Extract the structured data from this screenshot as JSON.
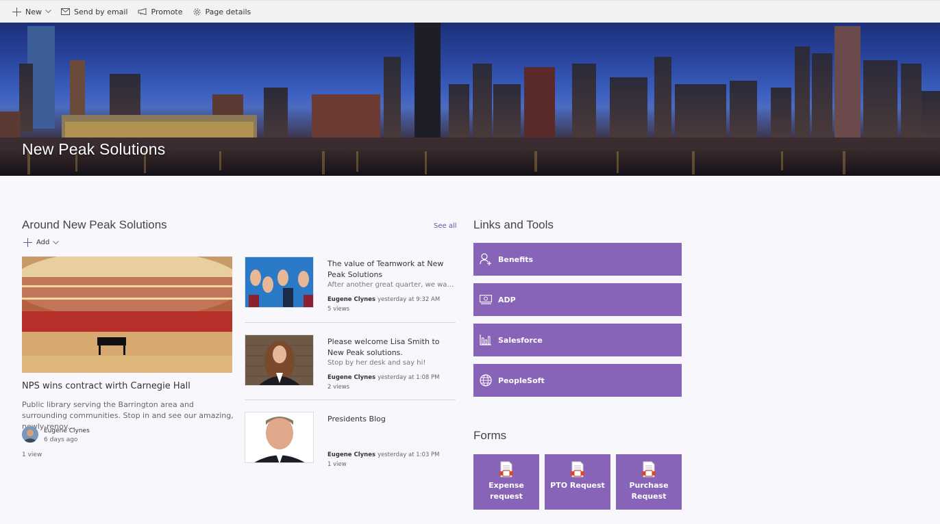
{
  "command_bar": {
    "new_label": "New",
    "send_label": "Send by email",
    "promote_label": "Promote",
    "details_label": "Page details"
  },
  "hero": {
    "title": "New Peak Solutions"
  },
  "news": {
    "title": "Around New Peak Solutions",
    "see_all": "See all",
    "add_label": "Add",
    "featured": {
      "title": "NPS wins contract wirth Carnegie Hall",
      "description": "Public library serving the Barrington area and surrounding communities. Stop in and see our amazing, newly-renov...",
      "author": "Eugene Clynes",
      "date": "6 days ago",
      "views": "1 view"
    },
    "items": [
      {
        "title": "The value of Teamwork at New Peak Solutions",
        "description": "After another great quarter, we wan...",
        "author": "Eugene Clynes",
        "date": "yesterday at 9:32 AM",
        "views": "5 views"
      },
      {
        "title": "Please welcome Lisa Smith to New Peak solutions.",
        "description": "Stop by her desk and say hi!",
        "author": "Eugene Clynes",
        "date": "yesterday at 1:08 PM",
        "views": "2 views"
      },
      {
        "title": "Presidents Blog",
        "description": "",
        "author": "Eugene Clynes",
        "date": "yesterday at 1:03 PM",
        "views": "1 view"
      }
    ]
  },
  "links": {
    "title": "Links and Tools",
    "items": [
      {
        "label": "Benefits",
        "icon": "person-add-icon"
      },
      {
        "label": "ADP",
        "icon": "money-icon"
      },
      {
        "label": "Salesforce",
        "icon": "bar-chart-icon"
      },
      {
        "label": "PeopleSoft",
        "icon": "globe-icon"
      }
    ]
  },
  "forms": {
    "title": "Forms",
    "items": [
      {
        "label": "Expense request",
        "icon": "form-document-icon"
      },
      {
        "label": "PTO Request",
        "icon": "form-document-icon"
      },
      {
        "label": "Purchase Request",
        "icon": "form-document-icon"
      }
    ]
  },
  "colors": {
    "accent": "#8764b8",
    "link": "#6b4fa0",
    "page_bg": "#f8f7fc",
    "command_bar_bg": "#f2f2f2"
  }
}
